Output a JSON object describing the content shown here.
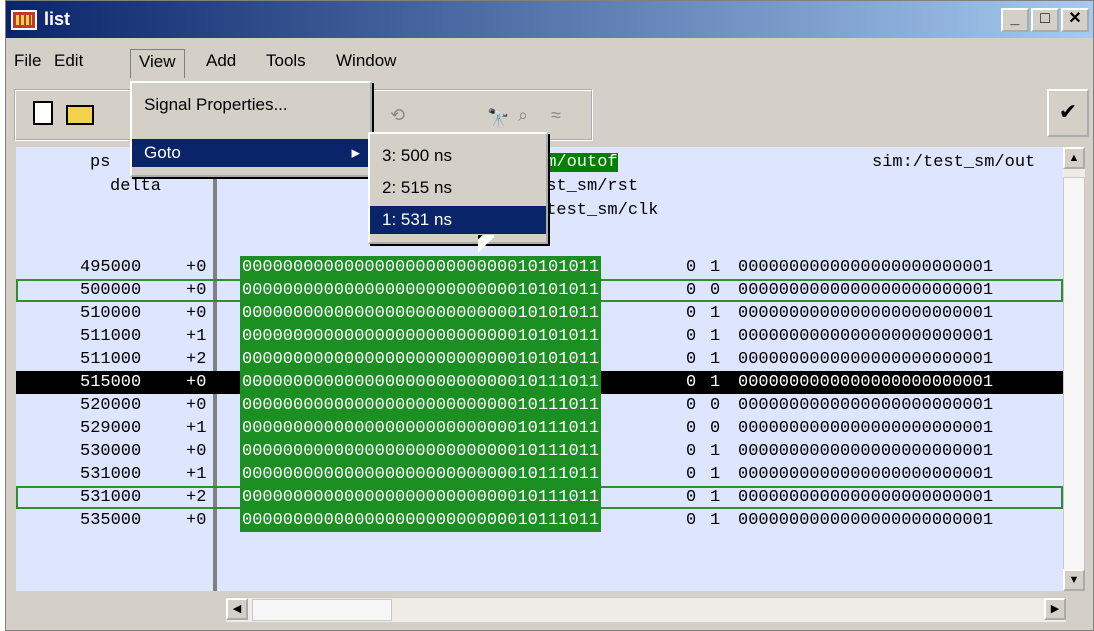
{
  "window": {
    "title": "list",
    "min": "_",
    "max": "□",
    "close": "✕"
  },
  "menubar": {
    "file": "File",
    "edit": "Edit",
    "view": "View",
    "add": "Add",
    "tools": "Tools",
    "window": "Window"
  },
  "toolbar": {
    "icons": [
      "new-doc-icon",
      "open-folder-icon",
      "binoculars-icon",
      "zoom-icon",
      "wave-icon",
      "check-tool-icon"
    ]
  },
  "view_menu": {
    "signal_properties": "Signal Properties...",
    "goto": "Goto",
    "submenu_arrow": "▸"
  },
  "goto_menu": [
    {
      "label": "3: 500 ns"
    },
    {
      "label": "2: 515 ns"
    },
    {
      "label": "1: 531 ns"
    }
  ],
  "headers": {
    "ps": "ps",
    "delta": "delta",
    "outof": "sm/outof",
    "rst": "est_sm/rst",
    "clk": "/test_sm/clk",
    "right": "sim:/test_sm/out"
  },
  "rows": [
    {
      "ps": "495000",
      "delta": "+0",
      "outof": "00000000000000000000000000010101011",
      "rst": "0",
      "clk": "1",
      "out": "0000000000000000000000001"
    },
    {
      "ps": "500000",
      "delta": "+0",
      "outof": "00000000000000000000000000010101011",
      "rst": "0",
      "clk": "0",
      "out": "0000000000000000000000001"
    },
    {
      "ps": "510000",
      "delta": "+0",
      "outof": "00000000000000000000000000010101011",
      "rst": "0",
      "clk": "1",
      "out": "0000000000000000000000001"
    },
    {
      "ps": "511000",
      "delta": "+1",
      "outof": "00000000000000000000000000010101011",
      "rst": "0",
      "clk": "1",
      "out": "0000000000000000000000001"
    },
    {
      "ps": "511000",
      "delta": "+2",
      "outof": "00000000000000000000000000010101011",
      "rst": "0",
      "clk": "1",
      "out": "0000000000000000000000001"
    },
    {
      "ps": "515000",
      "delta": "+0",
      "outof": "00000000000000000000000000010111011",
      "rst": "0",
      "clk": "1",
      "out": "0000000000000000000000001"
    },
    {
      "ps": "520000",
      "delta": "+0",
      "outof": "00000000000000000000000000010111011",
      "rst": "0",
      "clk": "0",
      "out": "0000000000000000000000001"
    },
    {
      "ps": "529000",
      "delta": "+1",
      "outof": "00000000000000000000000000010111011",
      "rst": "0",
      "clk": "0",
      "out": "0000000000000000000000001"
    },
    {
      "ps": "530000",
      "delta": "+0",
      "outof": "00000000000000000000000000010111011",
      "rst": "0",
      "clk": "1",
      "out": "0000000000000000000000001"
    },
    {
      "ps": "531000",
      "delta": "+1",
      "outof": "00000000000000000000000000010111011",
      "rst": "0",
      "clk": "1",
      "out": "0000000000000000000000001"
    },
    {
      "ps": "531000",
      "delta": "+2",
      "outof": "00000000000000000000000000010111011",
      "rst": "0",
      "clk": "1",
      "out": "0000000000000000000000001"
    },
    {
      "ps": "535000",
      "delta": "+0",
      "outof": "00000000000000000000000000010111011",
      "rst": "0",
      "clk": "1",
      "out": "0000000000000000000000001"
    }
  ]
}
